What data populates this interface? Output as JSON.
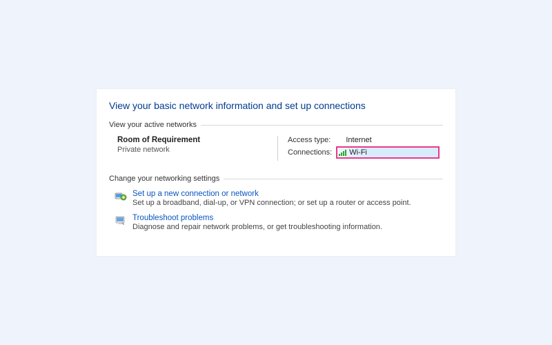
{
  "header": "View your basic network information and set up connections",
  "groups": {
    "active_networks": {
      "title": "View your active networks",
      "network_name": "Room of Requirement",
      "network_profile": "Private network",
      "access_type_label": "Access type:",
      "access_type_value": "Internet",
      "connections_label": "Connections:",
      "connection_name": "Wi-Fi"
    },
    "change_settings": {
      "title": "Change your networking settings",
      "items": [
        {
          "link": "Set up a new connection or network",
          "desc": "Set up a broadband, dial-up, or VPN connection; or set up a router or access point."
        },
        {
          "link": "Troubleshoot problems",
          "desc": "Diagnose and repair network problems, or get troubleshooting information."
        }
      ]
    }
  }
}
